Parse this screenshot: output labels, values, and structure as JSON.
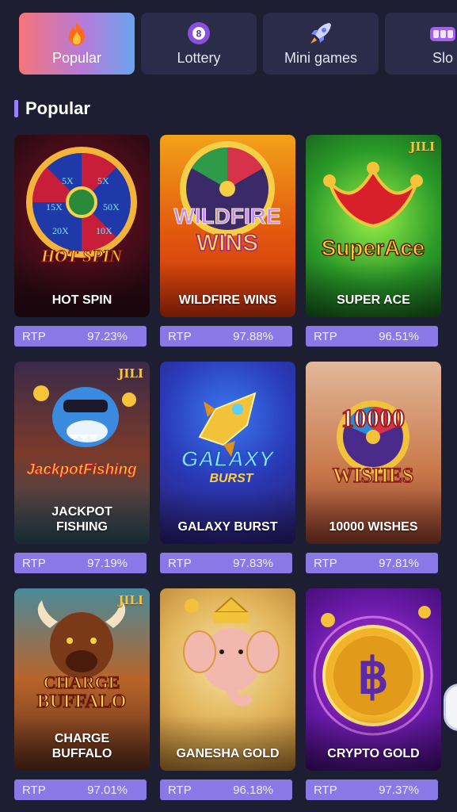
{
  "tabs": [
    {
      "label": "Popular",
      "icon": "fire-icon",
      "active": true
    },
    {
      "label": "Lottery",
      "icon": "lottery-ball-icon",
      "active": false
    },
    {
      "label": "Mini games",
      "icon": "rocket-icon",
      "active": false
    },
    {
      "label": "Slo",
      "icon": "slots-icon",
      "active": false
    }
  ],
  "section": {
    "title": "Popular"
  },
  "rtp_label": "RTP",
  "games": [
    {
      "name": "HOT SPIN",
      "rtp": "97.23%"
    },
    {
      "name": "WILDFIRE WINS",
      "rtp": "97.88%",
      "jili": false
    },
    {
      "name": "SUPER ACE",
      "rtp": "96.51%",
      "badge": "JILI"
    },
    {
      "name": "JACKPOT FISHING",
      "rtp": "97.19%",
      "badge": "JILI"
    },
    {
      "name": "GALAXY BURST",
      "rtp": "97.83%"
    },
    {
      "name": "10000 WISHES",
      "rtp": "97.81%"
    },
    {
      "name": "CHARGE BUFFALO",
      "rtp": "97.01%",
      "badge": "JILI"
    },
    {
      "name": "GANESHA GOLD",
      "rtp": "96.18%"
    },
    {
      "name": "CRYPTO GOLD",
      "rtp": "97.37%"
    }
  ],
  "art_text": {
    "hot_spin": "HOT SPIN",
    "wildfire": "WILDFIRE",
    "wins": "WINS",
    "super_ace": "SuperAce",
    "jackpot_fishing": "JackpotFishing",
    "galaxy": "GALAXY",
    "burst": "BURST",
    "wishes_num": "10000",
    "wishes": "WISHES",
    "charge": "CHARGE",
    "buffalo": "BUFFALO"
  },
  "colors": {
    "accent": "#8a78e6",
    "background": "#1d1e32",
    "tab": "#2b2c4a"
  }
}
